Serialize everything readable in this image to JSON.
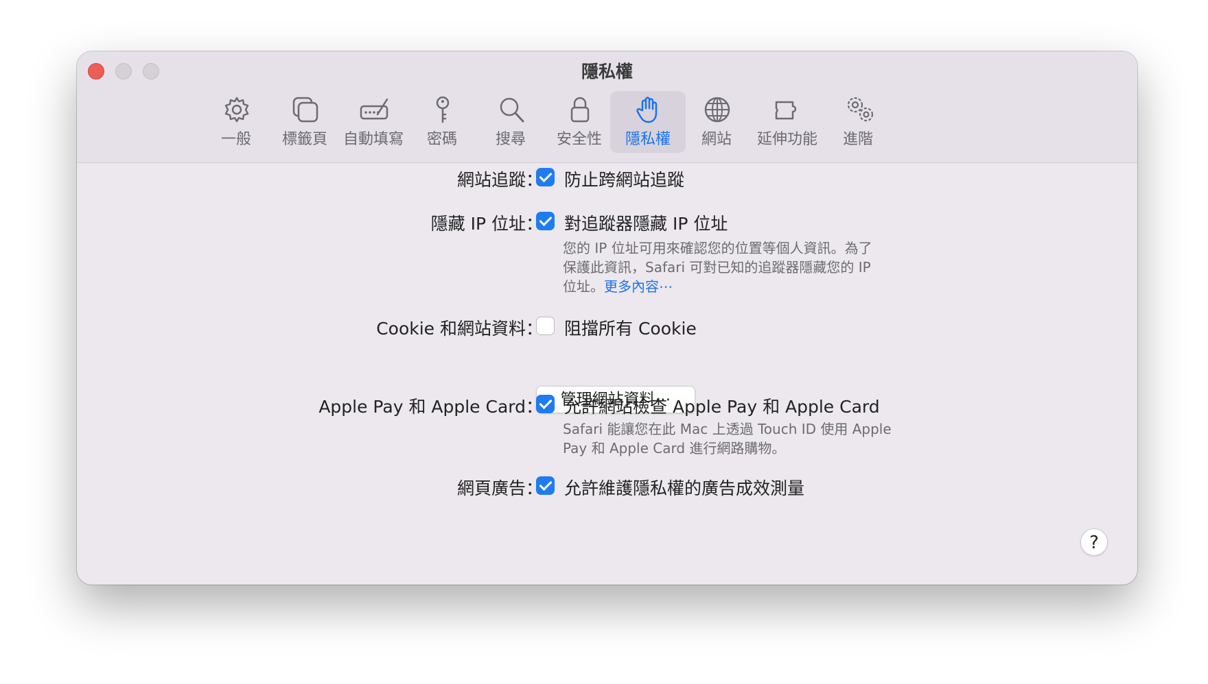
{
  "window": {
    "title": "隱私權"
  },
  "toolbar": {
    "tabs": [
      {
        "label": "一般",
        "icon": "gear-icon"
      },
      {
        "label": "標籤頁",
        "icon": "tabs-icon"
      },
      {
        "label": "自動填寫",
        "icon": "autofill-icon"
      },
      {
        "label": "密碼",
        "icon": "key-icon"
      },
      {
        "label": "搜尋",
        "icon": "search-icon"
      },
      {
        "label": "安全性",
        "icon": "lock-icon"
      },
      {
        "label": "隱私權",
        "icon": "hand-icon",
        "selected": true
      },
      {
        "label": "網站",
        "icon": "globe-icon"
      },
      {
        "label": "延伸功能",
        "icon": "extension-icon"
      },
      {
        "label": "進階",
        "icon": "gears-icon"
      }
    ]
  },
  "settings": {
    "tracking": {
      "label": "網站追蹤：",
      "option": "防止跨網站追蹤",
      "checked": true
    },
    "hide_ip": {
      "label": "隱藏 IP 位址：",
      "option": "對追蹤器隱藏 IP 位址",
      "checked": true,
      "description_lines": [
        "您的 IP 位址可用來確認您的位置等個人資訊。為了",
        "保護此資訊，Safari 可對已知的追蹤器隱藏您的 IP",
        "位址。"
      ],
      "more_link": "更多內容⋯"
    },
    "cookies": {
      "label": "Cookie 和網站資料：",
      "option": "阻擋所有 Cookie",
      "checked": false,
      "button": "管理網站資料⋯"
    },
    "apple_pay": {
      "label": "Apple Pay 和 Apple Card：",
      "option": "允許網站檢查 Apple Pay 和 Apple Card",
      "checked": true,
      "description_lines": [
        "Safari 能讓您在此 Mac 上透過 Touch ID 使用 Apple",
        "Pay 和 Apple Card 進行網路購物。"
      ]
    },
    "ads": {
      "label": "網頁廣告：",
      "option": "允許維護隱私權的廣告成效測量",
      "checked": true
    }
  },
  "help": {
    "label": "?"
  },
  "colors": {
    "accent": "#1e7cf0",
    "close": "#ee5d57",
    "window_bg": "#ece8ee"
  }
}
